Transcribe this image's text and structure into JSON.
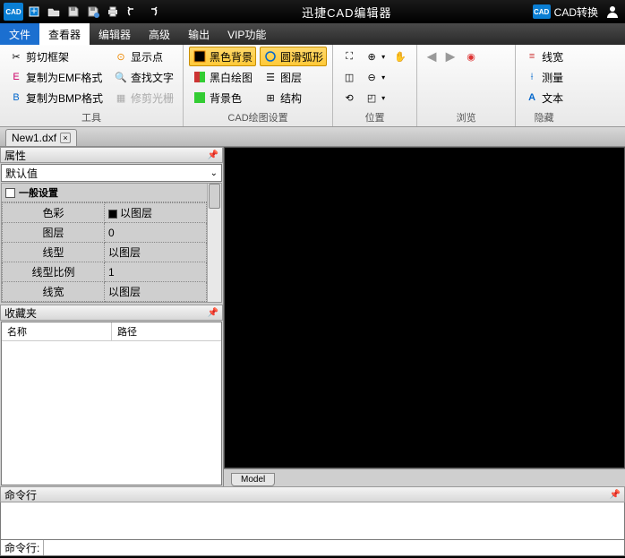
{
  "title": "迅捷CAD编辑器",
  "titlebar": {
    "cad_convert": "CAD转换"
  },
  "menu": {
    "file": "文件",
    "viewer": "查看器",
    "editor": "编辑器",
    "advanced": "高级",
    "output": "输出",
    "vip": "VIP功能"
  },
  "ribbon": {
    "tools_group": "工具",
    "crop_frame": "剪切框架",
    "copy_emf": "复制为EMF格式",
    "copy_bmp": "复制为BMP格式",
    "show_points": "显示点",
    "find_text": "查找文字",
    "trim_raster": "修剪光栅",
    "cad_settings_group": "CAD绘图设置",
    "black_bg": "黑色背景",
    "bw_draw": "黑白绘图",
    "bg_color": "背景色",
    "smooth_arc": "圆滑弧形",
    "layers": "图层",
    "structure": "结构",
    "position_group": "位置",
    "browse_group": "浏览",
    "hide_group": "隐藏",
    "line_width": "线宽",
    "measure": "测量",
    "text": "文本"
  },
  "file_tab": {
    "name": "New1.dxf"
  },
  "props": {
    "title": "属性",
    "default_value": "默认值",
    "general": "一般设置",
    "rows": [
      {
        "k": "色彩",
        "v": "以图层",
        "swatch": true
      },
      {
        "k": "图层",
        "v": "0"
      },
      {
        "k": "线型",
        "v": "以图层"
      },
      {
        "k": "线型比例",
        "v": "1"
      },
      {
        "k": "线宽",
        "v": "以图层"
      }
    ]
  },
  "fav": {
    "title": "收藏夹",
    "col_name": "名称",
    "col_path": "路径"
  },
  "canvas": {
    "model_tab": "Model"
  },
  "cmd": {
    "title": "命令行",
    "prompt": "命令行:"
  }
}
